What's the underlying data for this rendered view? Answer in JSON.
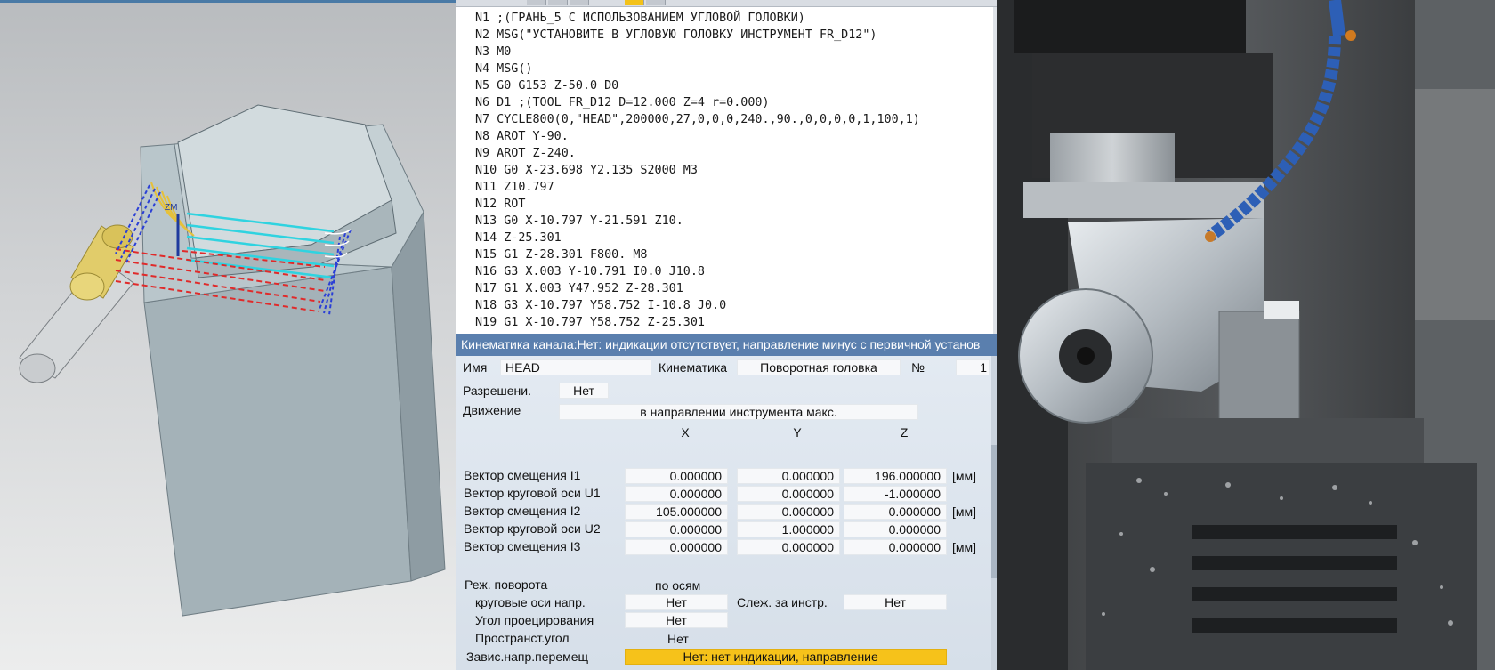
{
  "cad_view": {
    "triad_label": "ZM"
  },
  "nc_program": {
    "lines": [
      "N1 ;(ГРАНЬ_5 С ИСПОЛЬЗОВАНИЕМ УГЛОВОЙ ГОЛОВКИ)",
      "N2 MSG(\"УСТАНОВИТЕ В УГЛОВУЮ ГОЛОВКУ ИНСТРУМЕНТ FR_D12\")",
      "N3 M0",
      "N4 MSG()",
      "N5 G0 G153 Z-50.0 D0",
      "N6 D1 ;(TOOL FR_D12 D=12.000 Z=4 r=0.000)",
      "N7 CYCLE800(0,\"HEAD\",200000,27,0,0,0,240.,90.,0,0,0,0,1,100,1)",
      "N8 AROT Y-90.",
      "N9 AROT Z-240.",
      "N10 G0 X-23.698 Y2.135 S2000 M3",
      "N11 Z10.797",
      "N12 ROT",
      "N13 G0 X-10.797 Y-21.591 Z10.",
      "N14 Z-25.301",
      "N15 G1 Z-28.301 F800. M8",
      "N16 G3 X.003 Y-10.791 I0.0 J10.8",
      "N17 G1 X.003 Y47.952 Z-28.301",
      "N18 G3 X-10.797 Y58.752 I-10.8 J0.0",
      "N19 G1 X-10.797 Y58.752 Z-25.301"
    ]
  },
  "kinematics": {
    "title": "Кинематика канала:Нет: индикации отсутствует, направление минус с первичной установ",
    "name_label": "Имя",
    "name_value": "HEAD",
    "kinematics_label": "Кинематика",
    "kinematics_value": "Поворотная головка",
    "number_label": "№",
    "number_value": "1",
    "allowed_label": "Разрешени.",
    "allowed_value": "Нет",
    "motion_label": "Движение",
    "motion_value": "в направлении инструмента макс.",
    "col_x": "X",
    "col_y": "Y",
    "col_z": "Z",
    "unit_mm": "[мм]",
    "vectors": [
      {
        "label": "Вектор смещения I1",
        "x": "0.000000",
        "y": "0.000000",
        "z": "196.000000",
        "unit": true
      },
      {
        "label": "Вектор круговой оси U1",
        "x": "0.000000",
        "y": "0.000000",
        "z": "-1.000000",
        "unit": false
      },
      {
        "label": "Вектор смещения I2",
        "x": "105.000000",
        "y": "0.000000",
        "z": "0.000000",
        "unit": true
      },
      {
        "label": "Вектор круговой оси U2",
        "x": "0.000000",
        "y": "1.000000",
        "z": "0.000000",
        "unit": false
      },
      {
        "label": "Вектор смещения I3",
        "x": "0.000000",
        "y": "0.000000",
        "z": "0.000000",
        "unit": true
      }
    ],
    "rotation_mode_label": "Реж. поворота",
    "rotation_mode_value": "по осям",
    "rotary_dir_label": "круговые оси напр.",
    "rotary_dir_value": "Нет",
    "tool_follow_label": "Слеж. за инстр.",
    "tool_follow_value": "Нет",
    "proj_angle_label": "Угол проецирования",
    "proj_angle_value": "Нет",
    "space_angle_label": "Пространст.угол",
    "space_angle_value": "Нет",
    "dep_dir_label": "Завис.напр.перемещ",
    "dep_dir_value": "Нет: нет индикации, направление –"
  },
  "colors": {
    "title_bar": "#5a7fae",
    "highlight": "#f6c21a",
    "part": "#b7c3c8",
    "toolpath_cyan": "#2fd3e0",
    "toolpath_red": "#e02a2a",
    "toolpath_blue": "#2a3fd6"
  }
}
